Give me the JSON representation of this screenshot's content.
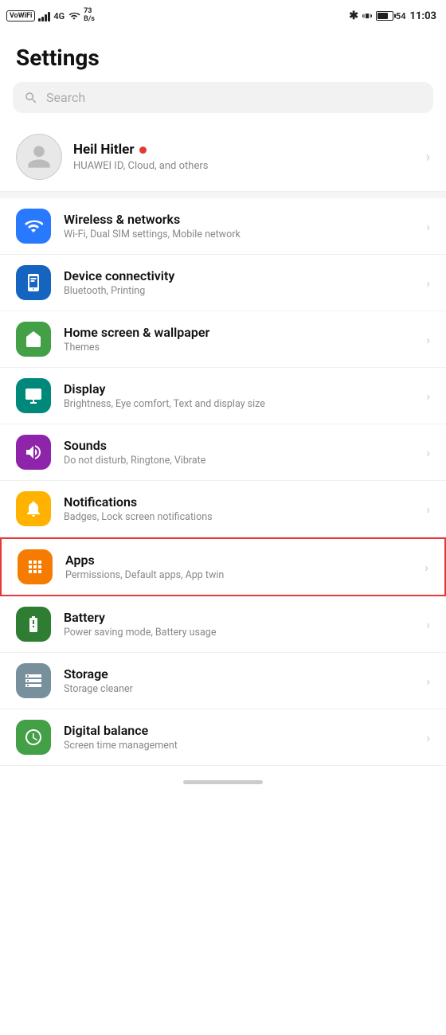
{
  "statusBar": {
    "carrier": "VoWiFi",
    "signal": "4G",
    "speed": "73\nB/s",
    "bluetooth": "✱",
    "battery": "54",
    "time": "11:03"
  },
  "pageTitle": "Settings",
  "search": {
    "placeholder": "Search"
  },
  "profile": {
    "name": "Heil Hitler",
    "subtitle": "HUAWEI ID, Cloud, and others"
  },
  "settingsItems": [
    {
      "id": "wireless",
      "iconColor": "icon-blue",
      "iconSymbol": "wifi",
      "title": "Wireless & networks",
      "subtitle": "Wi-Fi, Dual SIM settings, Mobile network",
      "highlighted": false
    },
    {
      "id": "connectivity",
      "iconColor": "icon-blue2",
      "iconSymbol": "devices",
      "title": "Device connectivity",
      "subtitle": "Bluetooth, Printing",
      "highlighted": false
    },
    {
      "id": "homescreen",
      "iconColor": "icon-green",
      "iconSymbol": "home",
      "title": "Home screen & wallpaper",
      "subtitle": "Themes",
      "highlighted": false
    },
    {
      "id": "display",
      "iconColor": "icon-teal",
      "iconSymbol": "display",
      "title": "Display",
      "subtitle": "Brightness, Eye comfort, Text and display size",
      "highlighted": false
    },
    {
      "id": "sounds",
      "iconColor": "icon-purple",
      "iconSymbol": "volume",
      "title": "Sounds",
      "subtitle": "Do not disturb, Ringtone, Vibrate",
      "highlighted": false
    },
    {
      "id": "notifications",
      "iconColor": "icon-amber",
      "iconSymbol": "bell",
      "title": "Notifications",
      "subtitle": "Badges, Lock screen notifications",
      "highlighted": false
    },
    {
      "id": "apps",
      "iconColor": "icon-orange",
      "iconSymbol": "apps",
      "title": "Apps",
      "subtitle": "Permissions, Default apps, App twin",
      "highlighted": true
    },
    {
      "id": "battery",
      "iconColor": "icon-battery-green",
      "iconSymbol": "battery",
      "title": "Battery",
      "subtitle": "Power saving mode, Battery usage",
      "highlighted": false
    },
    {
      "id": "storage",
      "iconColor": "icon-storage",
      "iconSymbol": "storage",
      "title": "Storage",
      "subtitle": "Storage cleaner",
      "highlighted": false
    },
    {
      "id": "digitalbalance",
      "iconColor": "icon-balance",
      "iconSymbol": "balance",
      "title": "Digital balance",
      "subtitle": "Screen time management",
      "highlighted": false
    }
  ]
}
